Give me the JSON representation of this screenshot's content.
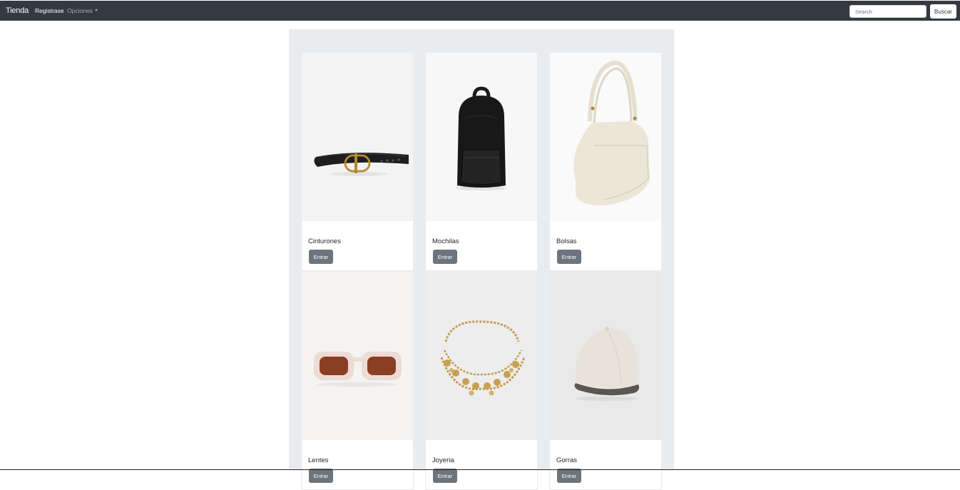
{
  "navbar": {
    "brand": "Tienda",
    "links": [
      {
        "label": "Registrase"
      },
      {
        "label": "Opciones"
      }
    ],
    "search": {
      "placeholder": "Search",
      "button_label": "Buscar"
    }
  },
  "products": [
    {
      "title": "Cinturones",
      "button_label": "Entrar",
      "image": "black-belt"
    },
    {
      "title": "Mochilas",
      "button_label": "Entrar",
      "image": "black-backpack"
    },
    {
      "title": "Bolsas",
      "button_label": "Entrar",
      "image": "cream-shoulder-bag"
    },
    {
      "title": "Lentes",
      "button_label": "Entrar",
      "image": "cream-sunglasses"
    },
    {
      "title": "Joyeria",
      "button_label": "Entrar",
      "image": "gold-coin-necklace"
    },
    {
      "title": "Gorras",
      "button_label": "Entrar",
      "image": "cream-cap"
    }
  ],
  "colors": {
    "navbar": "#343a40",
    "jumbotron": "#e9ecef",
    "button": "#6c757d"
  }
}
